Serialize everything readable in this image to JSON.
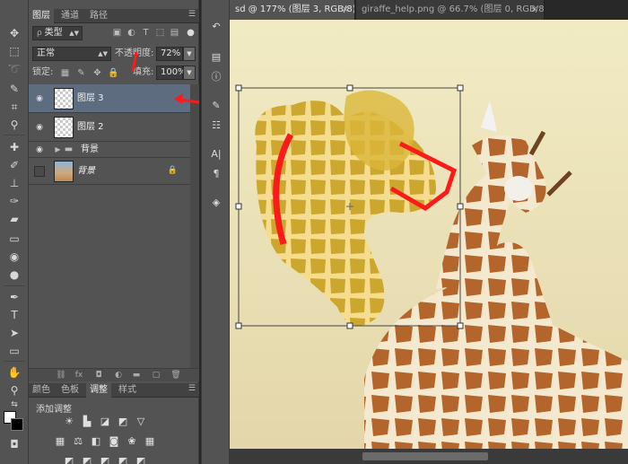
{
  "layers_panel": {
    "tabs": [
      "图层",
      "通道",
      "路径"
    ],
    "menu_icon": "panel-menu-icon",
    "filter_label": "类型",
    "blend_mode": "正常",
    "opacity_label": "不透明度:",
    "opacity_value": "72%",
    "lock_label": "锁定:",
    "fill_label": "填充:",
    "fill_value": "100%",
    "layers": [
      {
        "name": "图层 3",
        "selected": true,
        "visible": true
      },
      {
        "name": "图层 2",
        "selected": false,
        "visible": true
      },
      {
        "name": "背景",
        "selected": false,
        "visible": true,
        "group": true
      },
      {
        "name": "背景",
        "selected": false,
        "visible": false,
        "locked": true
      }
    ],
    "bottom_icons": [
      "link-icon",
      "fx-icon",
      "mask-icon",
      "adjustment-icon",
      "folder-icon",
      "new-layer-icon",
      "trash-icon"
    ]
  },
  "adjust_panel": {
    "tabs": [
      "颜色",
      "色板",
      "调整",
      "样式"
    ],
    "title": "添加调整"
  },
  "documents": {
    "tabs": [
      {
        "label": "sd @ 177% (图层 3, RGB/8) *",
        "close": "×"
      },
      {
        "label": "giraffe_help.png @ 66.7% (图层 0, RGB/8)",
        "close": "×"
      }
    ]
  },
  "colors": {
    "accent_red": "#ff1a1a",
    "panel_bg": "#535353",
    "selected_row": "#5e6c80"
  }
}
